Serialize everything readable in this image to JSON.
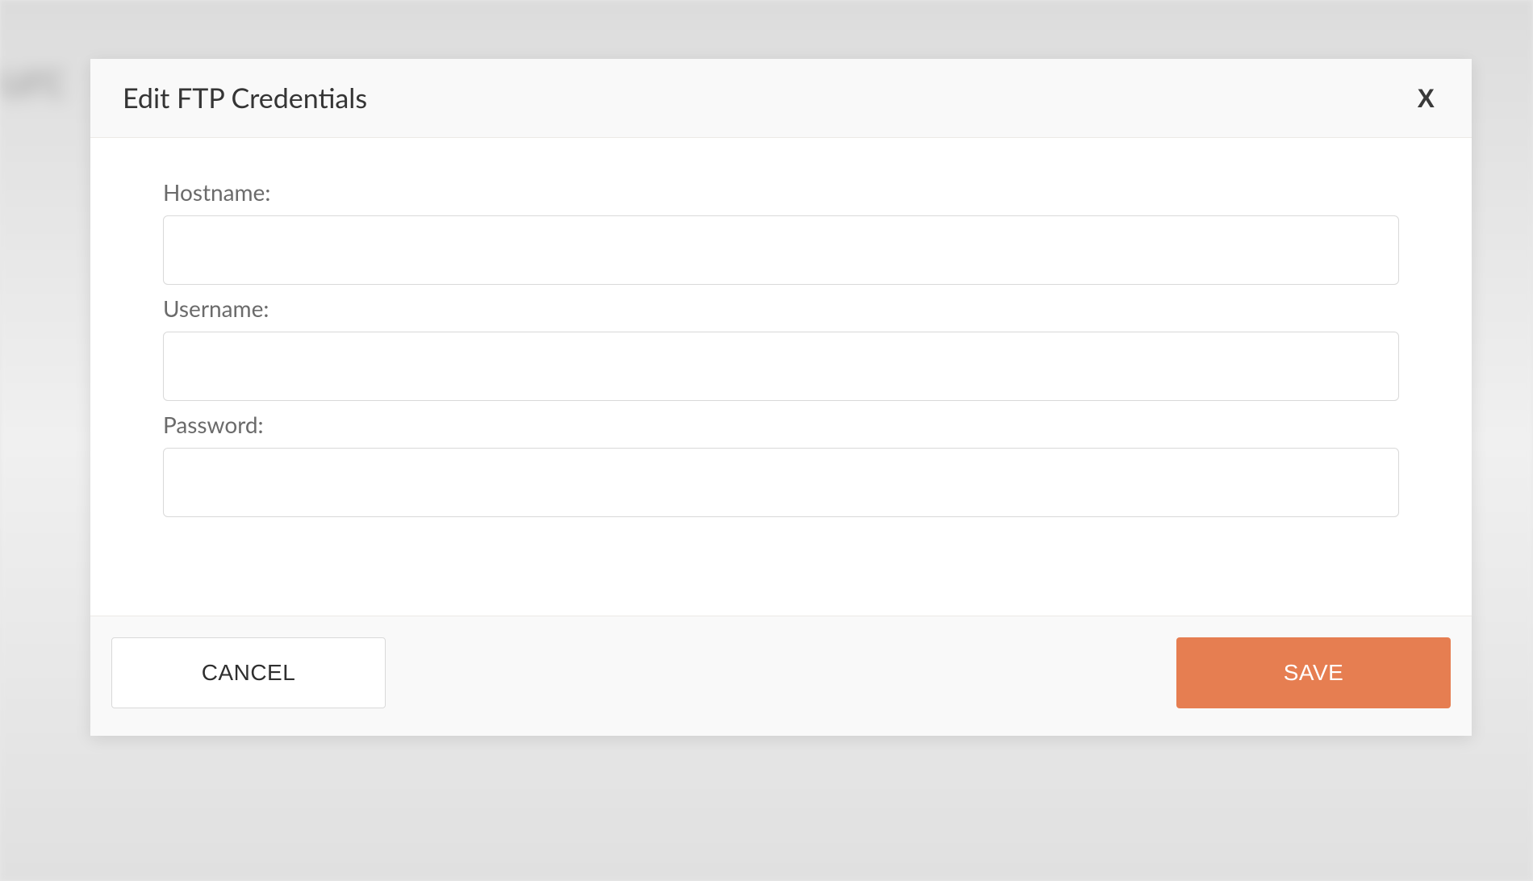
{
  "modal": {
    "title": "Edit FTP Credentials",
    "close_label": "X",
    "form": {
      "hostname": {
        "label": "Hostname:",
        "value": ""
      },
      "username": {
        "label": "Username:",
        "value": ""
      },
      "password": {
        "label": "Password:",
        "value": ""
      }
    },
    "buttons": {
      "cancel": "CANCEL",
      "save": "SAVE"
    }
  },
  "colors": {
    "accent": "#e67e51",
    "text_muted": "#6b6b6b",
    "border": "#d9d9d9"
  }
}
